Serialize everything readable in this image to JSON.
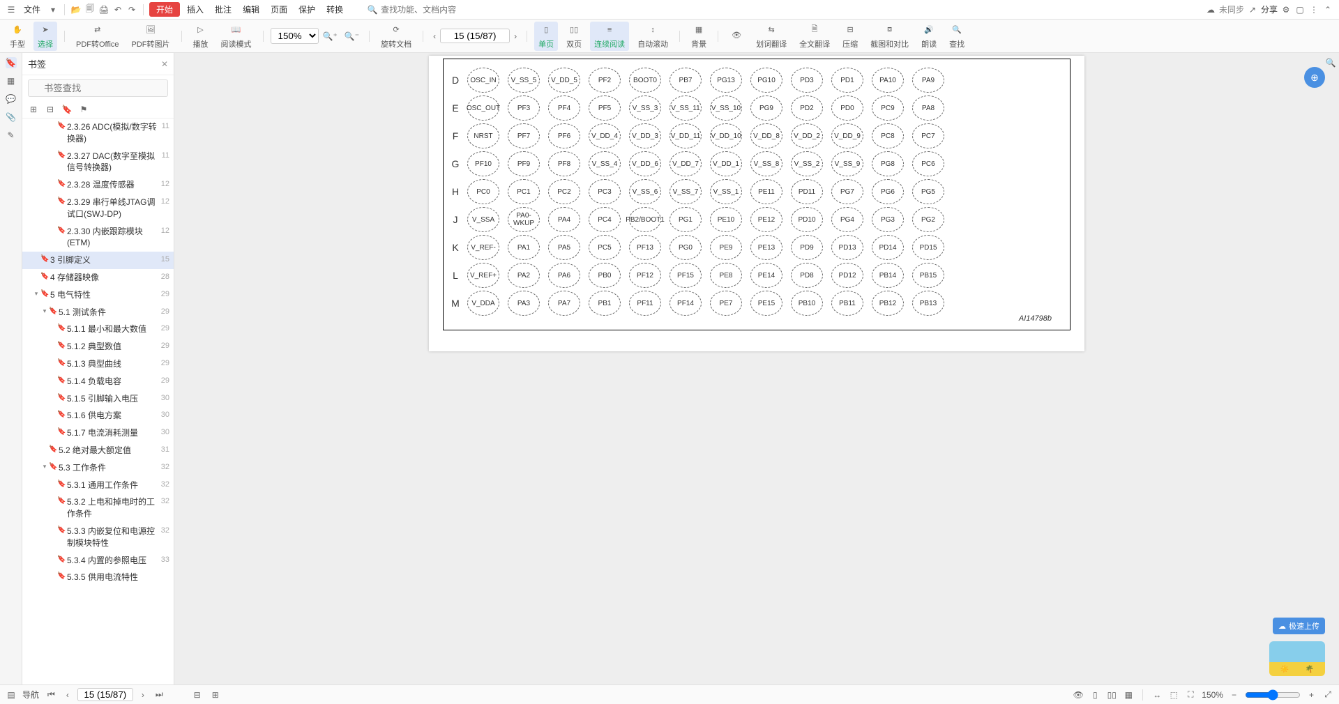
{
  "menu": {
    "file": "文件",
    "start": "开始",
    "insert": "插入",
    "review": "批注",
    "edit": "编辑",
    "page": "页面",
    "protect": "保护",
    "convert": "转换",
    "search_ph": "查找功能、文档内容",
    "unsync": "未同步",
    "share": "分享"
  },
  "toolbar": {
    "hand": "手型",
    "select": "选择",
    "pdf2office": "PDF转Office",
    "pdf2img": "PDF转图片",
    "play": "播放",
    "readmode": "阅读模式",
    "zoom": "150%",
    "rotate": "旋转文档",
    "single": "单页",
    "double": "双页",
    "continuous": "连续阅读",
    "autoscroll": "自动滚动",
    "bg": "背景",
    "eye": "",
    "dict": "划词翻译",
    "fulltrans": "全文翻译",
    "compress": "压缩",
    "compare": "截图和对比",
    "readaloud": "朗读",
    "find": "查找",
    "page_disp": "15 (15/87)"
  },
  "bookmarks": {
    "title": "书签",
    "search_ph": "书签查找",
    "items": [
      {
        "t": "2.3.26 ADC(模拟/数字转换器)",
        "p": "11",
        "ind": 3
      },
      {
        "t": "2.3.27 DAC(数字至模拟信号转换器)",
        "p": "11",
        "ind": 3
      },
      {
        "t": "2.3.28 温度传感器",
        "p": "12",
        "ind": 3
      },
      {
        "t": "2.3.29 串行单线JTAG调试口(SWJ-DP)",
        "p": "12",
        "ind": 3
      },
      {
        "t": "2.3.30 内嵌跟踪模块(ETM)",
        "p": "12",
        "ind": 3
      },
      {
        "t": "3 引脚定义",
        "p": "15",
        "ind": 1,
        "sel": true
      },
      {
        "t": "4 存储器映像",
        "p": "28",
        "ind": 1
      },
      {
        "t": "5 电气特性",
        "p": "29",
        "ind": 1,
        "arr": "▾"
      },
      {
        "t": "5.1 测试条件",
        "p": "29",
        "ind": 2,
        "arr": "▾"
      },
      {
        "t": "5.1.1 最小和最大数值",
        "p": "29",
        "ind": 3
      },
      {
        "t": "5.1.2 典型数值",
        "p": "29",
        "ind": 3
      },
      {
        "t": "5.1.3 典型曲线",
        "p": "29",
        "ind": 3
      },
      {
        "t": "5.1.4 负载电容",
        "p": "29",
        "ind": 3
      },
      {
        "t": "5.1.5 引脚输入电压",
        "p": "30",
        "ind": 3
      },
      {
        "t": "5.1.6 供电方案",
        "p": "30",
        "ind": 3
      },
      {
        "t": "5.1.7 电流消耗测量",
        "p": "30",
        "ind": 3
      },
      {
        "t": "5.2 绝对最大额定值",
        "p": "31",
        "ind": 2
      },
      {
        "t": "5.3 工作条件",
        "p": "32",
        "ind": 2,
        "arr": "▾"
      },
      {
        "t": "5.3.1 通用工作条件",
        "p": "32",
        "ind": 3
      },
      {
        "t": "5.3.2 上电和掉电时的工作条件",
        "p": "32",
        "ind": 3
      },
      {
        "t": "5.3.3 内嵌复位和电源控制模块特性",
        "p": "32",
        "ind": 3
      },
      {
        "t": "5.3.4 内置的参照电压",
        "p": "33",
        "ind": 3
      },
      {
        "t": "5.3.5 供用电流特性",
        "p": "",
        "ind": 3
      }
    ]
  },
  "pins": {
    "fig": "AI14798b",
    "rows": [
      {
        "l": "D",
        "c": [
          "OSC_IN",
          "V_SS_5",
          "V_DD_5",
          "PF2",
          "BOOT0",
          "PB7",
          "PG13",
          "PG10",
          "PD3",
          "PD1",
          "PA10",
          "PA9"
        ]
      },
      {
        "l": "E",
        "c": [
          "OSC_OUT",
          "PF3",
          "PF4",
          "PF5",
          "V_SS_3",
          "V_SS_11",
          "V_SS_10",
          "PG9",
          "PD2",
          "PD0",
          "PC9",
          "PA8"
        ]
      },
      {
        "l": "F",
        "c": [
          "NRST",
          "PF7",
          "PF6",
          "V_DD_4",
          "V_DD_3",
          "V_DD_11",
          "V_DD_10",
          "V_DD_8",
          "V_DD_2",
          "V_DD_9",
          "PC8",
          "PC7"
        ]
      },
      {
        "l": "G",
        "c": [
          "PF10",
          "PF9",
          "PF8",
          "V_SS_4",
          "V_DD_6",
          "V_DD_7",
          "V_DD_1",
          "V_SS_8",
          "V_SS_2",
          "V_SS_9",
          "PG8",
          "PC6"
        ]
      },
      {
        "l": "H",
        "c": [
          "PC0",
          "PC1",
          "PC2",
          "PC3",
          "V_SS_6",
          "V_SS_7",
          "V_SS_1",
          "PE11",
          "PD11",
          "PG7",
          "PG6",
          "PG5"
        ]
      },
      {
        "l": "J",
        "c": [
          "V_SSA",
          "PA0-WKUP",
          "PA4",
          "PC4",
          "PB2/BOOT1",
          "PG1",
          "PE10",
          "PE12",
          "PD10",
          "PG4",
          "PG3",
          "PG2"
        ]
      },
      {
        "l": "K",
        "c": [
          "V_REF-",
          "PA1",
          "PA5",
          "PC5",
          "PF13",
          "PG0",
          "PE9",
          "PE13",
          "PD9",
          "PD13",
          "PD14",
          "PD15"
        ]
      },
      {
        "l": "L",
        "c": [
          "V_REF+",
          "PA2",
          "PA6",
          "PB0",
          "PF12",
          "PF15",
          "PE8",
          "PE14",
          "PD8",
          "PD12",
          "PB14",
          "PB15"
        ]
      },
      {
        "l": "M",
        "c": [
          "V_DDA",
          "PA3",
          "PA7",
          "PB1",
          "PF11",
          "PF14",
          "PE7",
          "PE15",
          "PB10",
          "PB11",
          "PB12",
          "PB13"
        ]
      }
    ]
  },
  "status": {
    "nav": "导航",
    "page": "15 (15/87)",
    "zoom": "150%"
  },
  "float": {
    "upload": "极速上传"
  }
}
